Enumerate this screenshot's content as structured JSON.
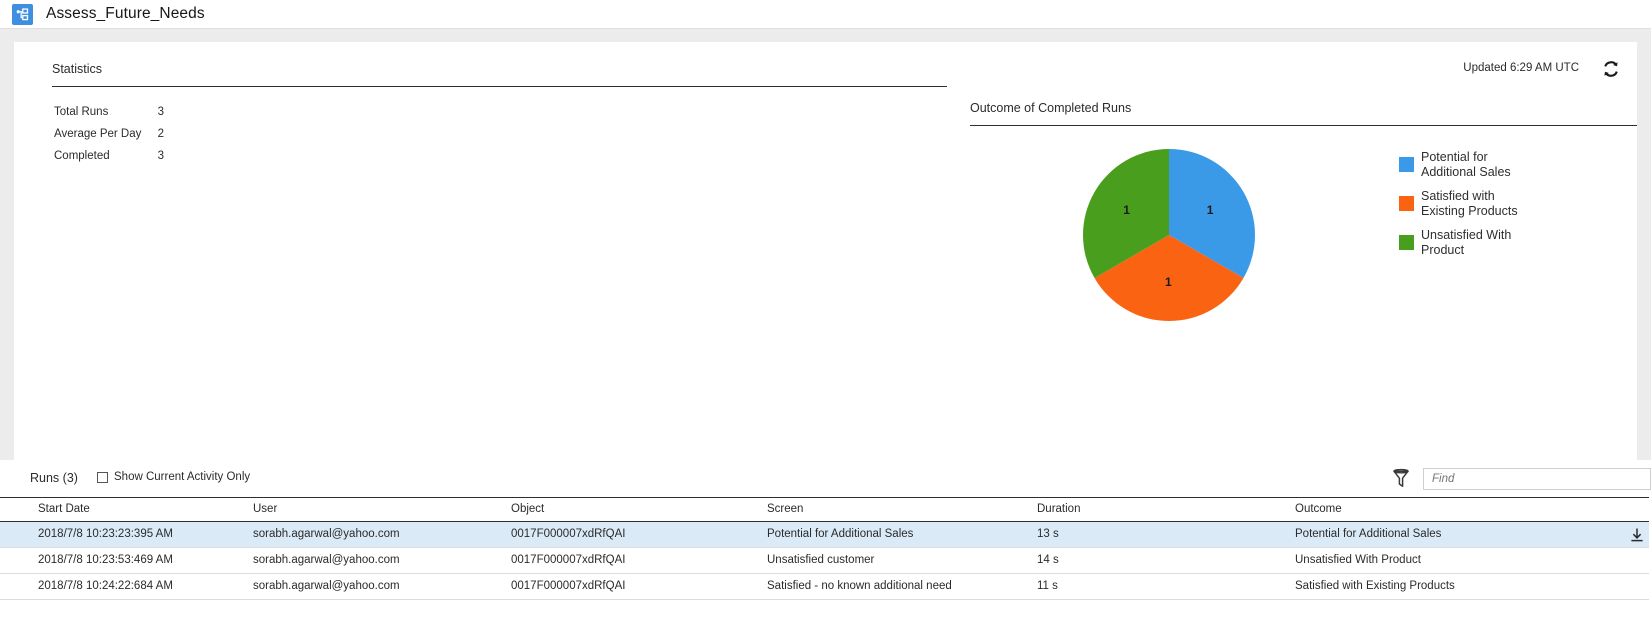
{
  "window": {
    "title": "Assess_Future_Needs",
    "app_icon": "flow-diagram-icon"
  },
  "statistics": {
    "heading": "Statistics",
    "updated_text": "Updated 6:29 AM UTC",
    "refresh_icon": "refresh-icon",
    "rows": [
      {
        "label": "Total Runs",
        "value": "3"
      },
      {
        "label": "Average Per Day",
        "value": "2"
      },
      {
        "label": "Completed",
        "value": "3"
      }
    ]
  },
  "chart_data": {
    "type": "pie",
    "title": "Outcome of Completed Runs",
    "xlabel": "",
    "ylabel": "",
    "grid": false,
    "legend_position": "right",
    "total": 3,
    "categories": [
      "Potential for Additional Sales",
      "Satisfied with Existing Products",
      "Unsatisfied With Product"
    ],
    "values": [
      1,
      1,
      1
    ],
    "data_labels": [
      "1",
      "1",
      "1"
    ],
    "colors": [
      "#3b9ae8",
      "#f96312",
      "#4a9e1e"
    ],
    "slices": [
      {
        "label": "Potential for Additional Sales",
        "value": 1,
        "percent": 33.3,
        "color": "#3b9ae8",
        "data_label": "1"
      },
      {
        "label": "Satisfied with Existing Products",
        "value": 1,
        "percent": 33.3,
        "color": "#f96312",
        "data_label": "1"
      },
      {
        "label": "Unsatisfied With Product",
        "value": 1,
        "percent": 33.3,
        "color": "#4a9e1e",
        "data_label": "1"
      }
    ]
  },
  "runs": {
    "title": "Runs (3)",
    "show_current_activity_label": "Show Current Activity Only",
    "show_current_activity_checked": false,
    "filter_icon": "funnel-filter-icon",
    "find_placeholder": "Find",
    "find_value": "",
    "columns": [
      "Start Date",
      "User",
      "Object",
      "Screen",
      "Duration",
      "Outcome"
    ],
    "rows": [
      {
        "start_date": "2018/7/8 10:23:23:395 AM",
        "user": "sorabh.agarwal@yahoo.com",
        "object": "0017F000007xdRfQAI",
        "screen": "Potential for Additional Sales",
        "duration": "13 s",
        "outcome": "Potential for Additional Sales",
        "selected": true,
        "download_icon": "download-icon"
      },
      {
        "start_date": "2018/7/8 10:23:53:469 AM",
        "user": "sorabh.agarwal@yahoo.com",
        "object": "0017F000007xdRfQAI",
        "screen": "Unsatisfied customer",
        "duration": "14 s",
        "outcome": "Unsatisfied With Product",
        "selected": false,
        "download_icon": ""
      },
      {
        "start_date": "2018/7/8 10:24:22:684 AM",
        "user": "sorabh.agarwal@yahoo.com",
        "object": "0017F000007xdRfQAI",
        "screen": "Satisfied - no known additional need",
        "duration": "11 s",
        "outcome": "Satisfied with Existing Products",
        "selected": false,
        "download_icon": ""
      }
    ]
  }
}
